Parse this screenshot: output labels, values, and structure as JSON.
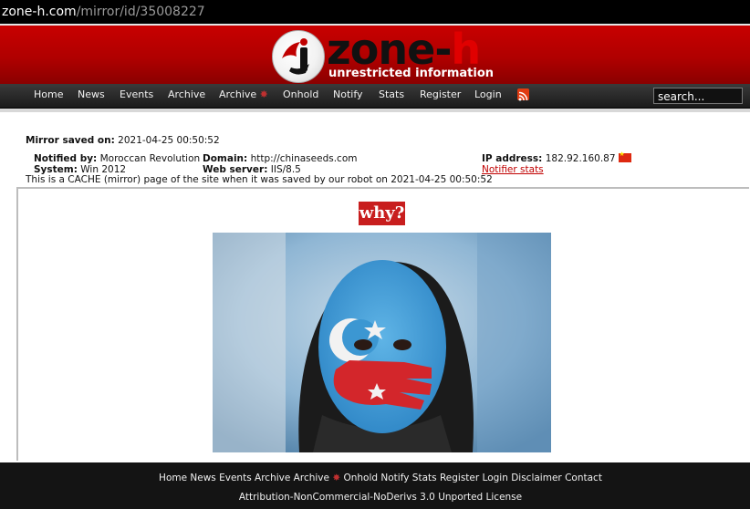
{
  "browser": {
    "url_host": "zone-h.com",
    "url_path": "/mirror/id/35008227"
  },
  "logo": {
    "word": "zone-",
    "word_end": "h",
    "tagline": "unrestricted information"
  },
  "nav": {
    "items": [
      "Home",
      "News",
      "Events",
      "Archive",
      "Archive",
      "Onhold",
      "Notify",
      "Stats",
      "Register",
      "Login"
    ],
    "search_placeholder": "search..."
  },
  "mirror": {
    "saved_label": "Mirror saved on:",
    "saved_value": "2021-04-25 00:50:52",
    "notified_label": "Notified by:",
    "notified_value": "Moroccan Revolution",
    "system_label": "System:",
    "system_value": "Win 2012",
    "domain_label": "Domain:",
    "domain_value": "http://chinaseeds.com",
    "webserver_label": "Web server:",
    "webserver_value": "IIS/8.5",
    "ip_label": "IP address:",
    "ip_value": "182.92.160.87",
    "notifier_stats": "Notifier stats",
    "cache_note": "This is a CACHE (mirror) page of the site when it was saved by our robot on 2021-04-25 00:50:52"
  },
  "mirror_content": {
    "heading": "why?"
  },
  "footer": {
    "links": [
      "Home",
      "News",
      "Events",
      "Archive",
      "Archive",
      "Onhold",
      "Notify",
      "Stats",
      "Register",
      "Login",
      "Disclaimer",
      "Contact"
    ],
    "license": "Attribution-NonCommercial-NoDerivs 3.0 Unported License"
  },
  "colors": {
    "banner_red": "#c80000",
    "nav_dark": "#2a2a2a",
    "why_red": "#c81e1e"
  }
}
